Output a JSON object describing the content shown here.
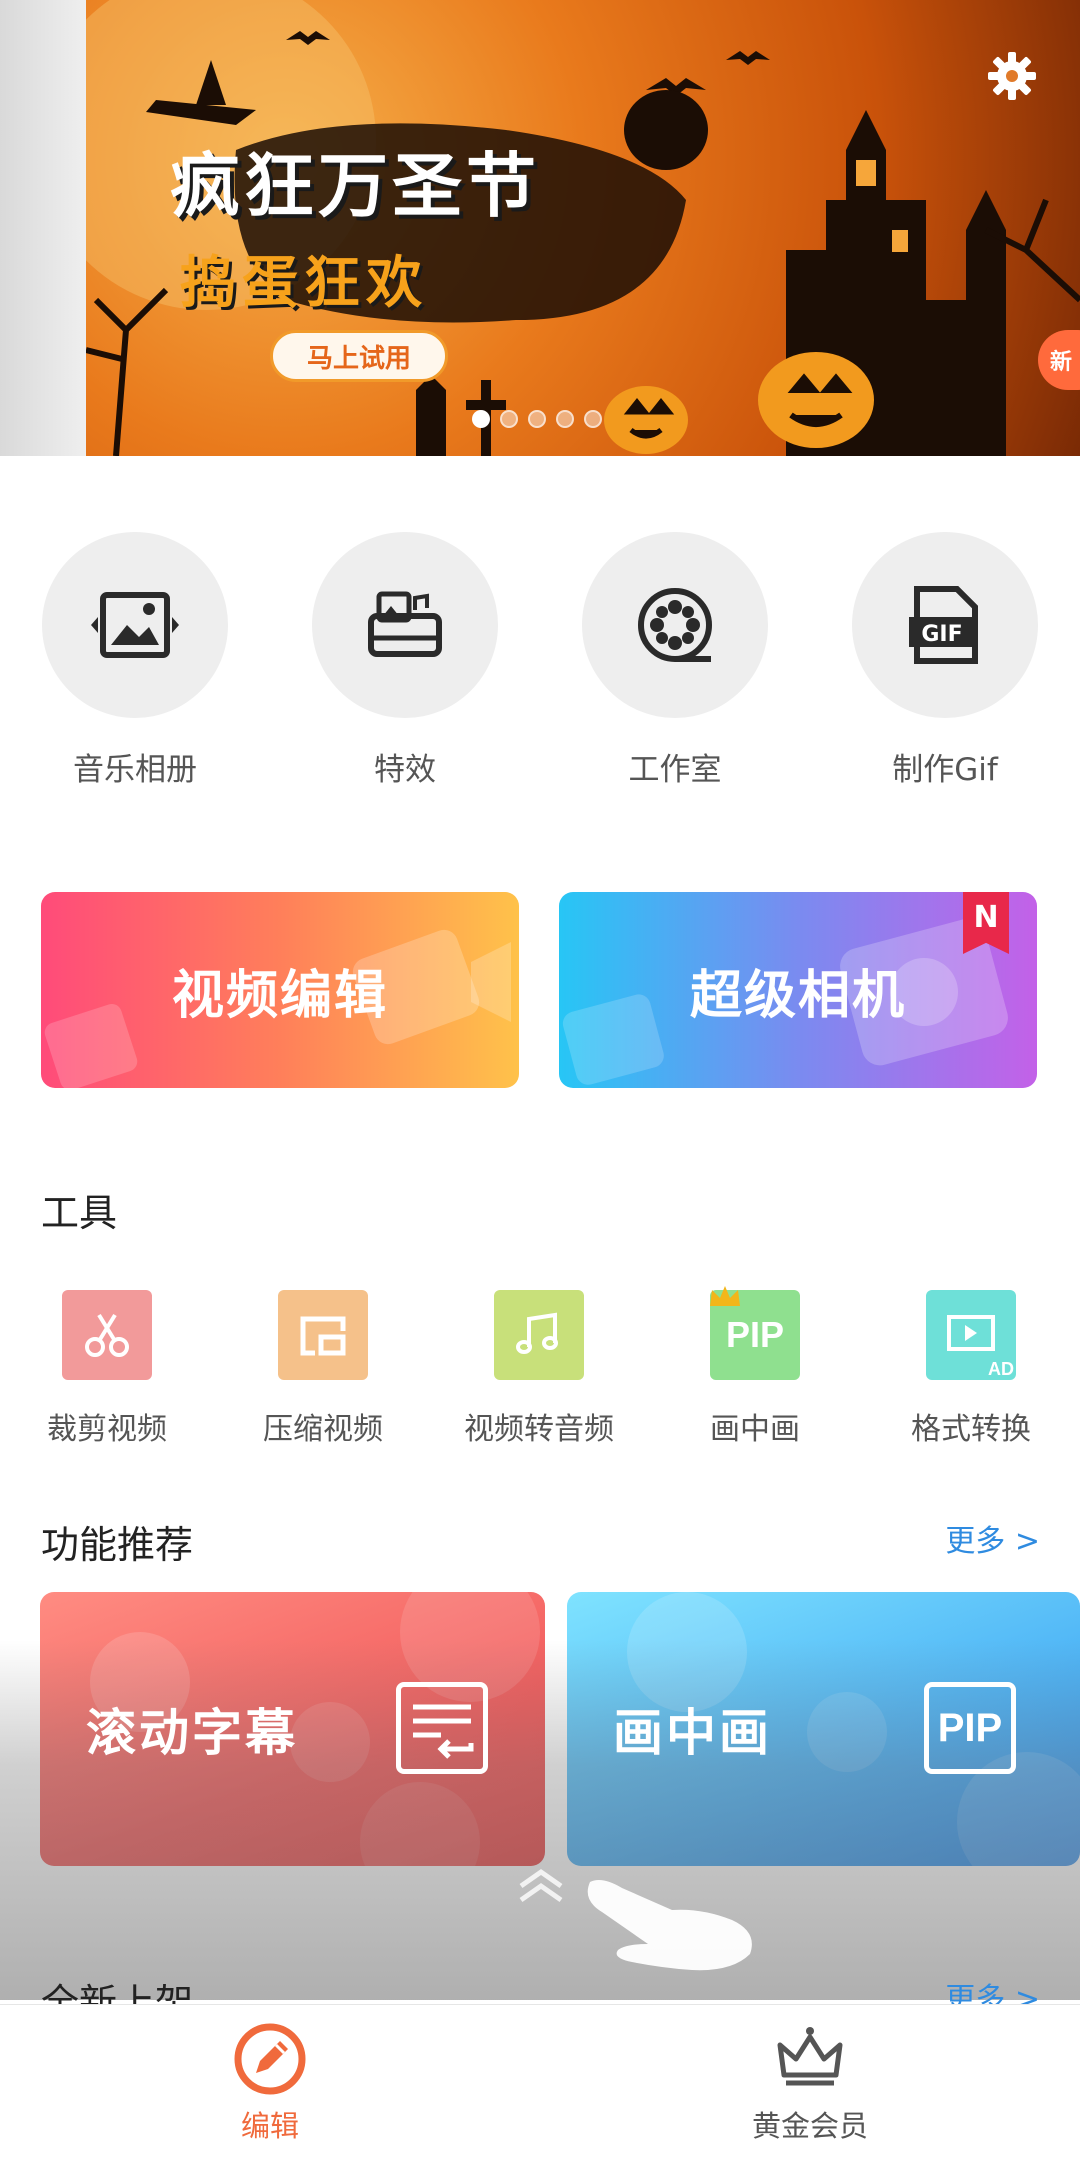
{
  "banner": {
    "title": "疯狂万圣节",
    "subtitle": "捣蛋狂欢",
    "cta": "马上试用",
    "side_badge": "新",
    "dots_total": 5,
    "active_dot": 1
  },
  "quick_actions": [
    {
      "label": "音乐相册",
      "icon": "photo-album-icon"
    },
    {
      "label": "特效",
      "icon": "effects-icon"
    },
    {
      "label": "工作室",
      "icon": "film-reel-icon"
    },
    {
      "label": "制作Gif",
      "icon": "gif-file-icon"
    }
  ],
  "big_cards": {
    "video_edit": "视频编辑",
    "super_camera": "超级相机",
    "new_badge": "N"
  },
  "tools": {
    "title": "工具",
    "items": [
      {
        "label": "裁剪视频",
        "icon": "scissors-icon",
        "color": "#f29a9a"
      },
      {
        "label": "压缩视频",
        "icon": "compress-icon",
        "color": "#f5c18a"
      },
      {
        "label": "视频转音频",
        "icon": "music-note-icon",
        "color": "#c8e07a"
      },
      {
        "label": "画中画",
        "icon": "pip-icon",
        "color": "#8fe08f",
        "icon_text": "PIP"
      },
      {
        "label": "格式转换",
        "icon": "format-convert-icon",
        "color": "#6ee0d8",
        "icon_text": "AD"
      }
    ]
  },
  "recommend": {
    "title": "功能推荐",
    "more": "更多 >",
    "cards": [
      {
        "label": "滚动字幕",
        "icon": "subtitle-icon"
      },
      {
        "label": "画中画",
        "icon": "pip-icon",
        "icon_text": "PIP"
      }
    ]
  },
  "new_arrivals": {
    "title": "全新上架",
    "more": "更多 >"
  },
  "bottom_nav": {
    "edit": "编辑",
    "vip": "黄金会员",
    "active_color": "#f06a3c"
  }
}
